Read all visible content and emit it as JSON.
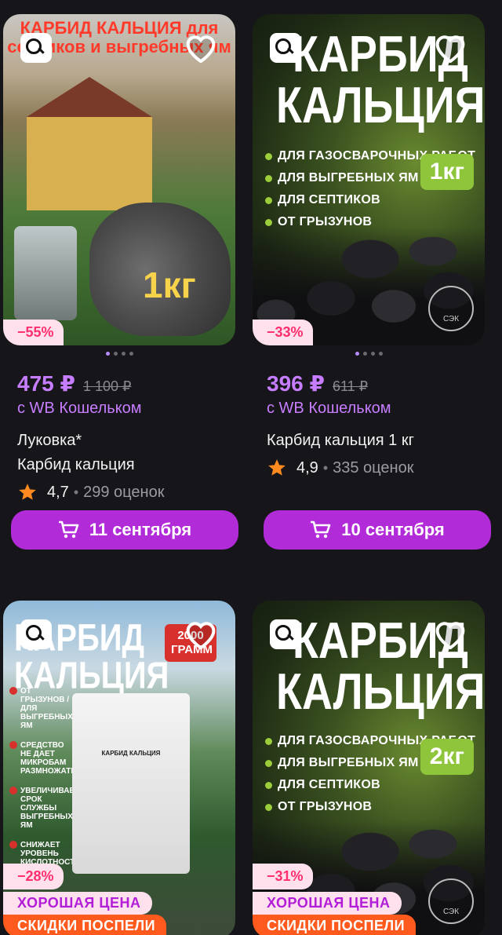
{
  "cards": [
    {
      "image": {
        "topline": "КАРБИД КАЛЬЦИЯ для септиков и выгребных ям",
        "weight_text": "1кг",
        "sale": "−55%"
      },
      "price": "475 ₽",
      "old_price": "1 100 ₽",
      "wallet": "с WB Кошельком",
      "title_line1": "Луковка*",
      "title_line2": "Карбид кальция",
      "rating": "4,7",
      "reviews": "299 оценок",
      "delivery": "11 сентября"
    },
    {
      "image": {
        "headline": "КАРБИД КАЛЬЦИЯ",
        "bullets": [
          "ДЛЯ ГАЗОСВАРОЧНЫХ РАБОТ",
          "ДЛЯ ВЫГРЕБНЫХ ЯМ",
          "ДЛЯ СЕПТИКОВ",
          "ОТ ГРЫЗУНОВ"
        ],
        "weight": "1кг",
        "seal": "СЭК",
        "sale": "−33%"
      },
      "price": "396 ₽",
      "old_price": "611 ₽",
      "wallet": "с WB Кошельком",
      "title_line1": "Карбид кальция 1 кг",
      "rating": "4,9",
      "reviews": "335 оценок",
      "delivery": "10 сентября"
    },
    {
      "image": {
        "headline": "КАРБИД КАЛЬЦИЯ",
        "tag": "2000 ГРАММ",
        "side_list": [
          "ОТ ГРЫЗУНОВ / ДЛЯ ВЫГРЕБНЫХ ЯМ",
          "СРЕДСТВО НЕ ДАЕТ МИКРОБАМ РАЗМНОЖАТЬСЯ",
          "УВЕЛИЧИВАЕТ СРОК СЛУЖБЫ ВЫГРЕБНЫХ ЯМ",
          "СНИЖАЕТ УРОВЕНЬ КИСЛОТНОСТИ"
        ],
        "pouch_title": "КАРБИД КАЛЬЦИЯ",
        "sale": "−28%",
        "good_price": "ХОРОШАЯ ЦЕНА",
        "discount_label": "СКИДКИ ПОСПЕЛИ"
      }
    },
    {
      "image": {
        "headline": "КАРБИД КАЛЬЦИЯ",
        "bullets": [
          "ДЛЯ ГАЗОСВАРОЧНЫХ РАБОТ",
          "ДЛЯ ВЫГРЕБНЫХ ЯМ",
          "ДЛЯ СЕПТИКОВ",
          "ОТ ГРЫЗУНОВ"
        ],
        "weight": "2кг",
        "seal": "СЭК",
        "sale": "−31%",
        "good_price": "ХОРОШАЯ ЦЕНА",
        "discount_label": "СКИДКИ ПОСПЕЛИ"
      }
    }
  ],
  "colors": {
    "background": "#161519",
    "accent": "#c77dff",
    "button": "#b22bd8",
    "sale_text": "#ff2f6d",
    "sale_bg": "#ffe1ee",
    "discount_bg": "#ff5a1e",
    "star": "#ff8a1f"
  },
  "icons": [
    "search-icon",
    "heart-icon",
    "star-icon",
    "cart-icon"
  ]
}
